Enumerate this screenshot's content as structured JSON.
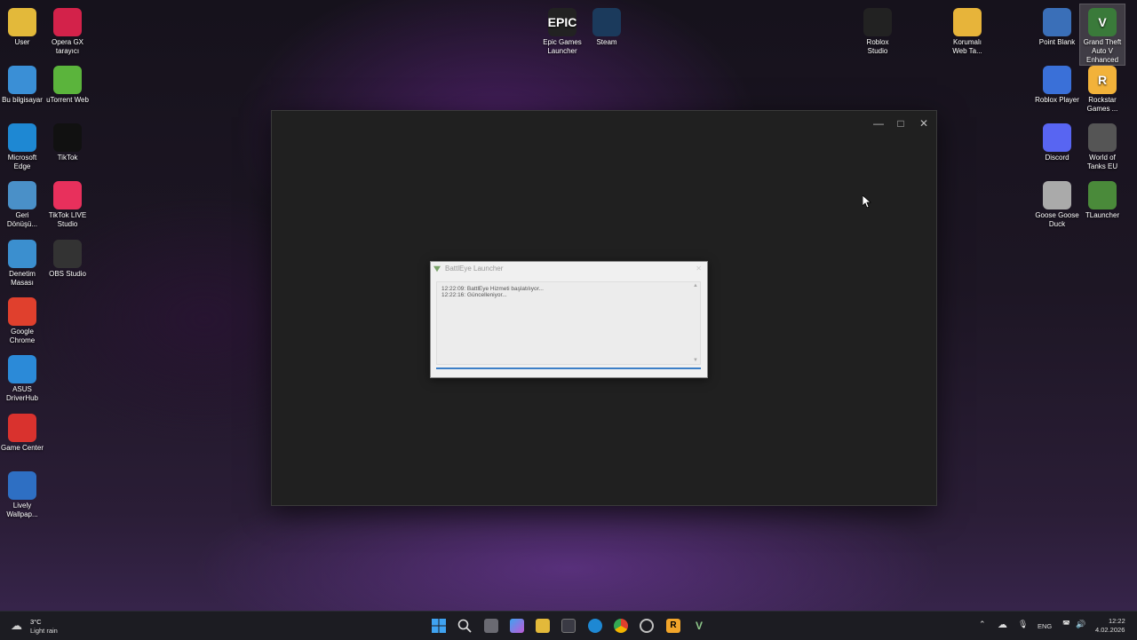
{
  "desktop": {
    "icons_left": [
      {
        "label": "User",
        "color": "#e3b93a"
      },
      {
        "label": "Opera GX\ntarayıcı",
        "color": "#d3224a"
      },
      {
        "label": "Bu bilgisayar",
        "color": "#3a8fd6"
      },
      {
        "label": "uTorrent Web",
        "color": "#5bb43c"
      },
      {
        "label": "Microsoft\nEdge",
        "color": "#1e88d3"
      },
      {
        "label": "TikTok",
        "color": "#111111"
      },
      {
        "label": "Geri\nDönüşü...",
        "color": "#4a90c8"
      },
      {
        "label": "TikTok LIVE\nStudio",
        "color": "#e8305c"
      },
      {
        "label": "Denetim\nMasası",
        "color": "#3b8fcf"
      },
      {
        "label": "OBS Studio",
        "color": "#333333"
      },
      {
        "label": "Google\nChrome",
        "color": "#e0402d"
      },
      {
        "label": "ASUS\nDriverHub",
        "color": "#2b8ad8"
      },
      {
        "label": "Game Center",
        "color": "#d9322e"
      },
      {
        "label": "Lively\nWallpap...",
        "color": "#2e6fc3"
      }
    ],
    "icons_top": [
      {
        "label": "Epic Games\nLauncher",
        "color": "#222222",
        "glyph": "EPIC"
      },
      {
        "label": "Steam",
        "color": "#1b3a5c"
      },
      {
        "label": "Roblox\nStudio",
        "color": "#222222"
      },
      {
        "label": "Korumalı\nWeb Ta...",
        "color": "#e7b43a"
      }
    ],
    "icons_right": [
      {
        "label": "Point Blank",
        "color": "#3a6fb8"
      },
      {
        "label": "Grand Theft\nAuto V\nEnhanced",
        "color": "#3a7a3a",
        "glyph": "V"
      },
      {
        "label": "Roblox Player",
        "color": "#3a70d8"
      },
      {
        "label": "Rockstar\nGames ...",
        "color": "#f2b23a",
        "glyph": "R"
      },
      {
        "label": "Discord",
        "color": "#5865f2"
      },
      {
        "label": "World of\nTanks EU",
        "color": "#555555"
      },
      {
        "label": "Goose Goose\nDuck",
        "color": "#aaaaaa"
      },
      {
        "label": "TLauncher",
        "color": "#4a8a3a"
      }
    ]
  },
  "battleye": {
    "title": "BattlEye Launcher",
    "log_line1": "12:22:09: BattlEye Hizmeti başlatılıyor...",
    "log_line2": "12:22:16: Güncelleniyor..."
  },
  "taskbar": {
    "weather_temp": "3°C",
    "weather_desc": "Light rain",
    "lang": "ENG",
    "time": "12:22",
    "date": "4.02.2026"
  },
  "colors": {
    "accent": "#3c7fc7",
    "window_bg": "#202020"
  }
}
